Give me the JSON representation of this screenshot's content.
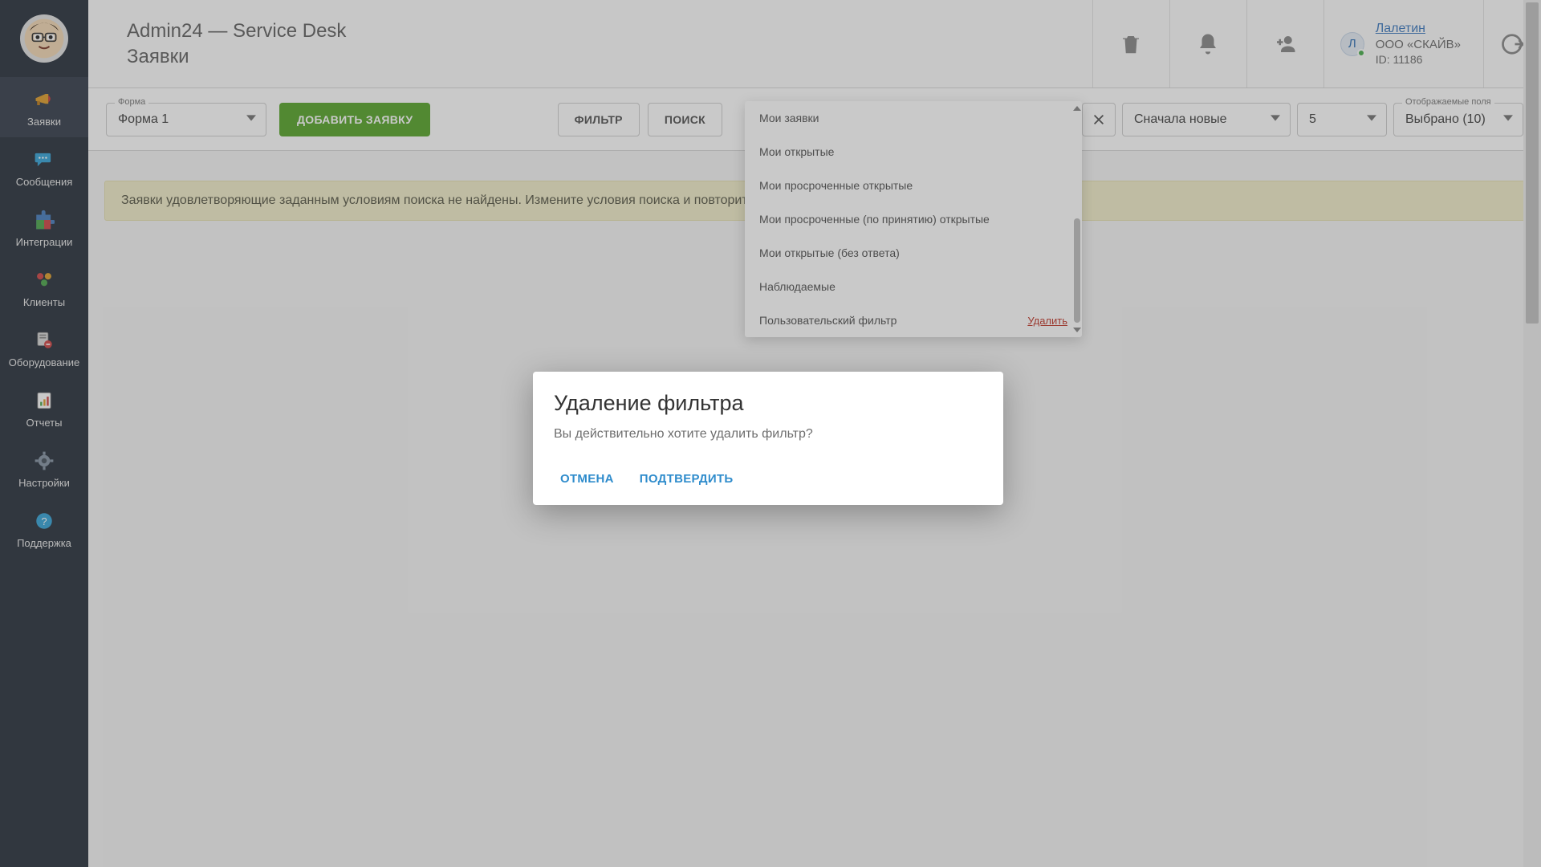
{
  "header": {
    "app_title": "Admin24 — Service Desk",
    "section_title": "Заявки",
    "user": {
      "initial": "Л",
      "name": "Лалетин",
      "company": "ООО «СКАЙВ»",
      "id_line": "ID: 11186"
    }
  },
  "sidebar": {
    "items": [
      {
        "label": "Заявки"
      },
      {
        "label": "Сообщения"
      },
      {
        "label": "Интеграции"
      },
      {
        "label": "Клиенты"
      },
      {
        "label": "Оборудование"
      },
      {
        "label": "Отчеты"
      },
      {
        "label": "Настройки"
      },
      {
        "label": "Поддержка"
      }
    ]
  },
  "toolbar": {
    "form_legend": "Форма",
    "form_value": "Форма 1",
    "add_button": "ДОБАВИТЬ ЗАЯВКУ",
    "filter_button": "ФИЛЬТР",
    "search_button": "ПОИСК",
    "sort_value": "Сначала новые",
    "page_value": "5",
    "fields_legend": "Отображаемые поля",
    "fields_value": "Выбрано (10)"
  },
  "infobar": {
    "message": "Заявки удовлетворяющие заданным условиям поиска не найдены. Измените условия поиска и повторит"
  },
  "filter_dropdown": {
    "items": [
      "Мои заявки",
      "Мои открытые",
      "Мои просроченные открытые",
      "Мои просроченные (по принятию) открытые",
      "Мои открытые (без ответа)",
      "Наблюдаемые",
      "Пользовательский фильтр"
    ],
    "delete_label": "Удалить"
  },
  "modal": {
    "title": "Удаление фильтра",
    "body": "Вы действительно хотите удалить фильтр?",
    "cancel": "ОТМЕНА",
    "confirm": "ПОДТВЕРДИТЬ"
  }
}
